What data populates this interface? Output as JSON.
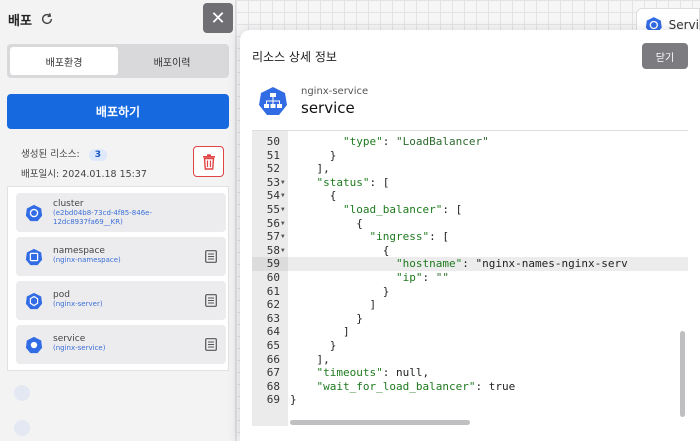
{
  "panel": {
    "title": "배포",
    "tabs": [
      "배포환경",
      "배포이력"
    ],
    "deploy_button": "배포하기",
    "created_resources_label": "생성된 리소스:",
    "created_resources_count": "3",
    "deployed_at": "배포일시: 2024.01.18 15:37",
    "close_symbol": "✕",
    "resources": [
      {
        "name": "cluster",
        "sub1": "(e2bd04b8-73cd-4f85-846e-",
        "sub2": "12dc8937fa69__KR)"
      },
      {
        "name": "namespace",
        "sub1": "(nginx-namespace)"
      },
      {
        "name": "pod",
        "sub1": "(nginx-server)"
      },
      {
        "name": "service",
        "sub1": "(nginx-service)"
      }
    ]
  },
  "background": {
    "node_label": "Servi"
  },
  "modal": {
    "title": "리소스 상세 정보",
    "close_label": "닫기",
    "resource_kind": "nginx-service",
    "resource_name": "service",
    "code_lines": [
      {
        "n": "50",
        "fold": false,
        "text": "        \"type\": \"LoadBalancer\""
      },
      {
        "n": "51",
        "fold": false,
        "text": "      }"
      },
      {
        "n": "52",
        "fold": false,
        "text": "    ],"
      },
      {
        "n": "53",
        "fold": true,
        "text": "    \"status\": ["
      },
      {
        "n": "54",
        "fold": true,
        "text": "      {"
      },
      {
        "n": "55",
        "fold": true,
        "text": "        \"load_balancer\": ["
      },
      {
        "n": "56",
        "fold": true,
        "text": "          {"
      },
      {
        "n": "57",
        "fold": true,
        "text": "            \"ingress\": ["
      },
      {
        "n": "58",
        "fold": true,
        "text": "              {"
      },
      {
        "n": "59",
        "fold": false,
        "text": "                \"hostname\": \"nginx-names-nginx-serv"
      },
      {
        "n": "60",
        "fold": false,
        "text": "                \"ip\": \"\""
      },
      {
        "n": "61",
        "fold": false,
        "text": "              }"
      },
      {
        "n": "62",
        "fold": false,
        "text": "            ]"
      },
      {
        "n": "63",
        "fold": false,
        "text": "          }"
      },
      {
        "n": "64",
        "fold": false,
        "text": "        ]"
      },
      {
        "n": "65",
        "fold": false,
        "text": "      }"
      },
      {
        "n": "66",
        "fold": false,
        "text": "    ],"
      },
      {
        "n": "67",
        "fold": false,
        "text": "    \"timeouts\": null,"
      },
      {
        "n": "68",
        "fold": false,
        "text": "    \"wait_for_load_balancer\": true"
      },
      {
        "n": "69",
        "fold": false,
        "text": "}"
      }
    ],
    "active_line": "59"
  },
  "colors": {
    "primary": "#1769e0",
    "danger": "#e04444",
    "close_bg": "#6f6f74",
    "key_green": "#1e7a1e",
    "k8s_blue": "#326ce5"
  }
}
